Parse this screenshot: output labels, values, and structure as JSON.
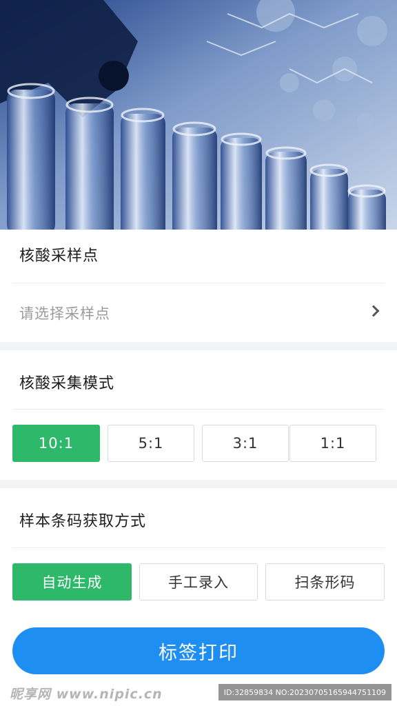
{
  "sampling_point": {
    "title": "核酸采样点",
    "placeholder": "请选择采样点"
  },
  "collection_mode": {
    "title": "核酸采集模式",
    "options": [
      "10:1",
      "5:1",
      "3:1",
      "1:1"
    ],
    "selected": "10:1"
  },
  "barcode_method": {
    "title": "样本条码获取方式",
    "options": [
      "自动生成",
      "手工录入",
      "扫条形码"
    ],
    "selected": "自动生成"
  },
  "print_button": {
    "label": "标签打印"
  },
  "watermark": {
    "logo": "昵享网 www.nipic.cn",
    "id_text": "ID:32859834 NO:20230705165944751109"
  },
  "colors": {
    "accent_green": "#2eb96a",
    "primary_blue": "#1f8ef2",
    "section_gap": "#f2f3f5"
  },
  "icons": {
    "picker_arrow": "chevron-right-icon"
  }
}
